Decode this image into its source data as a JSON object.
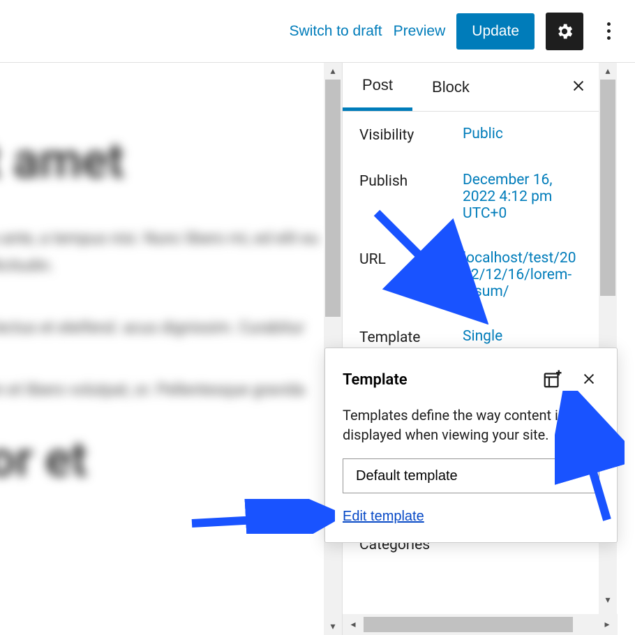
{
  "toolbar": {
    "switch_to_draft": "Switch to draft",
    "preview": "Preview",
    "update": "Update"
  },
  "sidebar": {
    "tabs": {
      "post": "Post",
      "block": "Block"
    },
    "rows": {
      "visibility": {
        "label": "Visibility",
        "value": "Public"
      },
      "publish": {
        "label": "Publish",
        "value": "December 16, 2022 4:12 pm UTC+0"
      },
      "url": {
        "label": "URL",
        "value": "localhost/test/2022/12/16/lorem-ipsum/"
      },
      "template": {
        "label": "Template",
        "value": "Single"
      }
    },
    "categories": "Categories"
  },
  "popover": {
    "title": "Template",
    "description": "Templates define the way content is displayed when viewing your site.",
    "select_value": "Default template",
    "edit_link": "Edit template"
  },
  "editor": {
    "title_fragment": "it amet",
    "p1": "inia ante, a tempus nisi. Nunc libero mi, ed elit eu sollicitudin.",
    "p2": "ac lectus et eleifend. acus dignissim. Curabitur",
    "p3": "dum et libero volutpat, or. Pellentesque gravida",
    "p4": "tor et"
  }
}
